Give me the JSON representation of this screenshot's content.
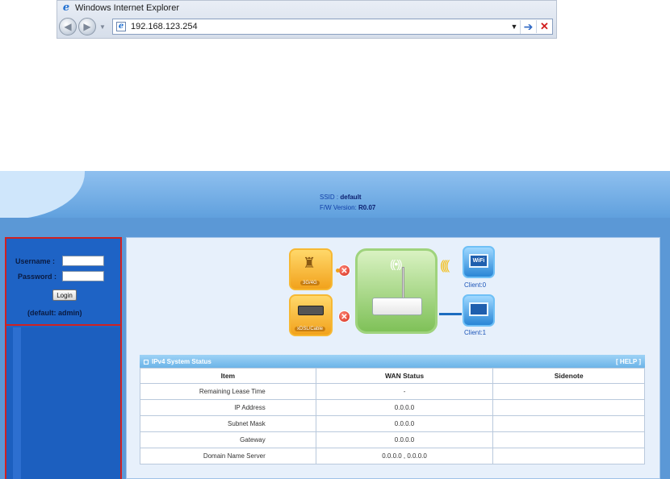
{
  "browser": {
    "title": "Windows Internet Explorer",
    "address": "192.168.123.254"
  },
  "header": {
    "ssid_label": "SSID :",
    "ssid_value": "default",
    "fw_label": "F/W Version:",
    "fw_value": "R0.07"
  },
  "login": {
    "username_label": "Username :",
    "password_label": "Password :",
    "button_label": "Login",
    "note": "(default: admin)"
  },
  "diagram": {
    "node_3g_label": "3G/4G",
    "node_xdsl_label": "xDSL/Cable",
    "client_wifi_label": "Client:0",
    "client_pc_label": "Client:1",
    "wifi_badge": "WiFi"
  },
  "status": {
    "title": "IPv4 System Status",
    "help": "[ HELP ]",
    "columns": [
      "Item",
      "WAN Status",
      "Sidenote"
    ],
    "rows": [
      {
        "item": "Remaining Lease Time",
        "value": "-",
        "note": ""
      },
      {
        "item": "IP Address",
        "value": "0.0.0.0",
        "note": ""
      },
      {
        "item": "Subnet Mask",
        "value": "0.0.0.0",
        "note": ""
      },
      {
        "item": "Gateway",
        "value": "0.0.0.0",
        "note": ""
      },
      {
        "item": "Domain Name Server",
        "value": "0.0.0.0 , 0.0.0.0",
        "note": ""
      }
    ]
  }
}
